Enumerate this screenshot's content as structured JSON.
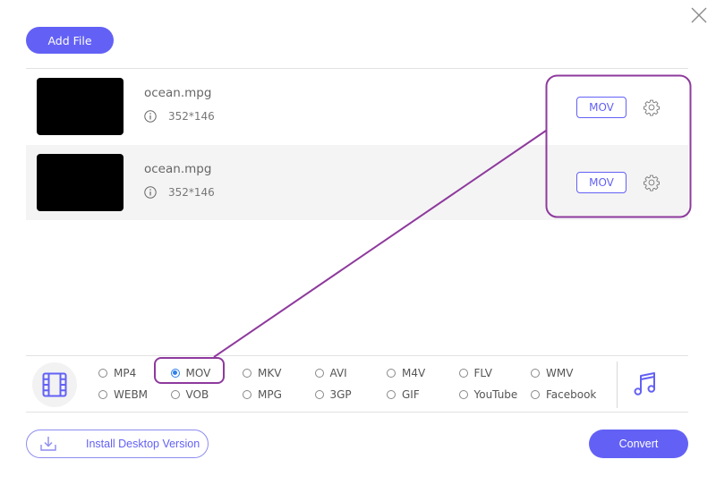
{
  "header": {
    "add_file_label": "Add File",
    "close_icon": "close-icon"
  },
  "files": [
    {
      "name": "ocean.mpg",
      "dimensions": "352*146",
      "format": "MOV",
      "info_icon": "info-icon",
      "settings_icon": "gear-icon"
    },
    {
      "name": "ocean.mpg",
      "dimensions": "352*146",
      "format": "MOV",
      "info_icon": "info-icon",
      "settings_icon": "gear-icon"
    }
  ],
  "format_bar": {
    "video_icon": "film-icon",
    "audio_icon": "music-note-icon",
    "selected": "MOV",
    "options": [
      "MP4",
      "MOV",
      "MKV",
      "AVI",
      "M4V",
      "FLV",
      "WMV",
      "WEBM",
      "VOB",
      "MPG",
      "3GP",
      "GIF",
      "YouTube",
      "Facebook"
    ]
  },
  "footer": {
    "install_label": "Install Desktop Version",
    "install_icon": "download-icon",
    "convert_label": "Convert"
  },
  "colors": {
    "accent": "#6361f5",
    "annotation": "#8e3a9d",
    "radio_selected": "#2f7fe8",
    "row_alt_bg": "#f4f4f4"
  }
}
